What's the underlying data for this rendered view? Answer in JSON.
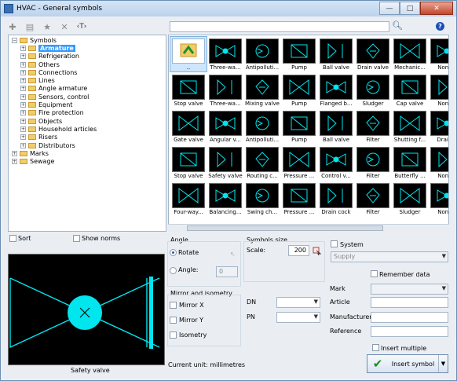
{
  "window": {
    "title": "HVAC - General symbols",
    "minimize": "—",
    "maximize": "□",
    "close": "✕"
  },
  "toolbar": {
    "add_icon": "plus-icon",
    "edit_icon": "edit-icon",
    "favorite_icon": "star-icon",
    "delete_icon": "delete-icon",
    "text_icon": "text-icon",
    "text_glyph": "‹T›"
  },
  "search": {
    "value": "",
    "help_glyph": "?"
  },
  "tree": {
    "items": [
      {
        "label": "Symbols",
        "level": 0,
        "exp": "−"
      },
      {
        "label": "Armature",
        "level": 1,
        "exp": "+",
        "selected": true
      },
      {
        "label": "Refrigeration",
        "level": 1,
        "exp": "+"
      },
      {
        "label": "Others",
        "level": 1,
        "exp": "+"
      },
      {
        "label": "Connections",
        "level": 1,
        "exp": "+"
      },
      {
        "label": "Lines",
        "level": 1,
        "exp": "+"
      },
      {
        "label": "Angle armature",
        "level": 1,
        "exp": "+"
      },
      {
        "label": "Sensors, control",
        "level": 1,
        "exp": "+"
      },
      {
        "label": "Equipment",
        "level": 1,
        "exp": "+"
      },
      {
        "label": "Fire protection",
        "level": 1,
        "exp": "+"
      },
      {
        "label": "Objects",
        "level": 1,
        "exp": "+"
      },
      {
        "label": "Household articles",
        "level": 1,
        "exp": "+"
      },
      {
        "label": "Risers",
        "level": 1,
        "exp": "+"
      },
      {
        "label": "Distributors",
        "level": 1,
        "exp": "+"
      },
      {
        "label": "Marks",
        "level": 0,
        "exp": "+"
      },
      {
        "label": "Sewage",
        "level": 0,
        "exp": "+"
      }
    ]
  },
  "symbols": [
    [
      "..",
      "Three-wa...",
      "Antipolluti...",
      "Pump",
      "Ball valve",
      "Drain valve",
      "Mechanic...",
      "Non-re"
    ],
    [
      "Stop valve",
      "Three-wa...",
      "Mixing valve",
      "Pump",
      "Flanged b...",
      "Sludger",
      "Cap valve",
      "Non-re"
    ],
    [
      "Gate valve",
      "Angular v...",
      "Antipolluti...",
      "Pump",
      "Ball valve",
      "Filter",
      "Shutting f...",
      "Drain v"
    ],
    [
      "Stop valve",
      "Safety valve",
      "Routing c...",
      "Pressure ...",
      "Control v...",
      "Filter",
      "Butterfly ...",
      "Non-re"
    ],
    [
      "Four-way...",
      "Balancing...",
      "Swing ch...",
      "Pressure ...",
      "Drain cock",
      "Filter",
      "Sludger",
      "Non-re"
    ]
  ],
  "options": {
    "sort_label": "Sort",
    "show_norms_label": "Show norms",
    "angle_title": "Angle",
    "rotate_label": "Rotate",
    "angle_label": "Angle:",
    "angle_value": "0",
    "mirror_title": "Mirror and isometry",
    "mirror_x_label": "Mirror X",
    "mirror_y_label": "Mirror Y",
    "isometry_label": "Isometry",
    "size_title": "Symbols size",
    "scale_label": "Scale:",
    "scale_value": "200",
    "system_label": "System",
    "system_value": "Supply",
    "remember_label": "Remember data",
    "dn_label": "DN",
    "pn_label": "PN",
    "mark_label": "Mark",
    "article_label": "Article",
    "manufacturer_label": "Manufacturer",
    "reference_label": "Reference",
    "insert_multiple_label": "Insert multiple",
    "insert_label": "Insert symbol",
    "current_unit": "Current unit: millimetres",
    "preview_caption": "Safety valve"
  },
  "colors": {
    "symbol": "#00e5ee",
    "preview_bg": "#000000",
    "selection": "#3399ff"
  }
}
